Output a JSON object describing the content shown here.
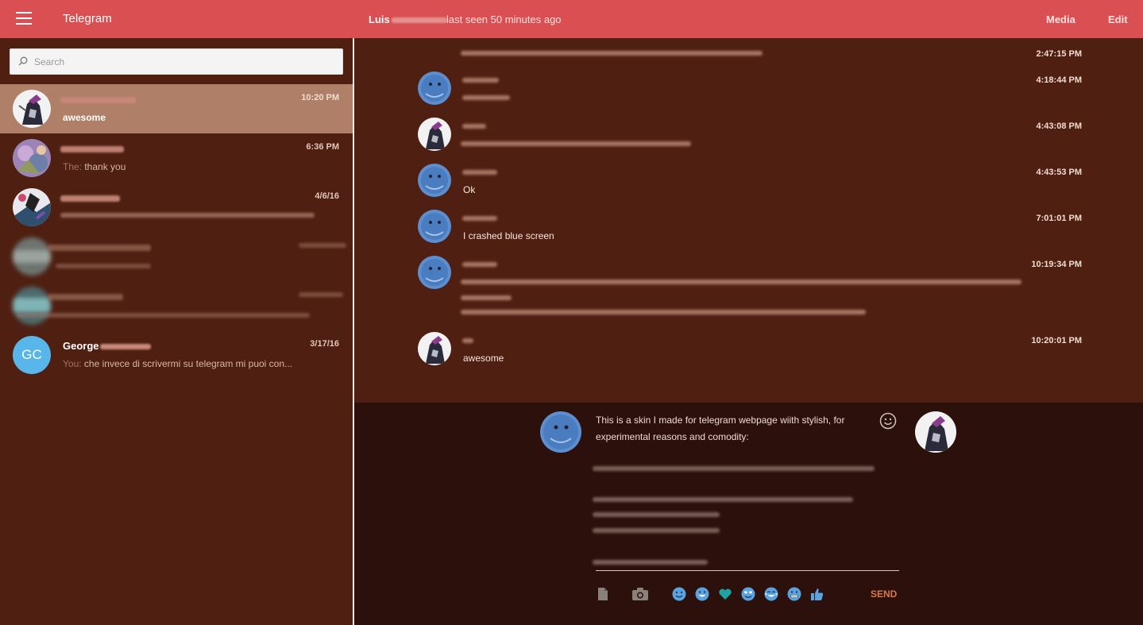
{
  "header": {
    "app_title": "Telegram",
    "peer_name": "Luis",
    "peer_status": "last seen 50 minutes ago",
    "media_label": "Media",
    "edit_label": "Edit"
  },
  "search": {
    "placeholder": "Search"
  },
  "dialogs": [
    {
      "time": "10:20 PM",
      "message": "awesome"
    },
    {
      "time": "6:36 PM",
      "from": "The:",
      "message": " thank you"
    },
    {
      "time": "4/6/16"
    },
    {},
    {},
    {
      "avatar_initials": "GC",
      "name": "George",
      "time": "3/17/16",
      "from": "You:",
      "message": " che invece di scrivermi su telegram mi puoi con..."
    }
  ],
  "messages": [
    {
      "time": "2:47:15 PM"
    },
    {
      "time": "4:18:44 PM"
    },
    {
      "time": "4:43:08 PM"
    },
    {
      "time": "4:43:53 PM",
      "text": "Ok"
    },
    {
      "time": "7:01:01 PM",
      "text": "I crashed blue screen"
    },
    {
      "time": "10:19:34 PM"
    },
    {
      "time": "10:20:01 PM",
      "text": "awesome"
    }
  ],
  "composer": {
    "draft_text": "This is a skin I made for telegram webpage wiith stylish, for experimental reasons and comodity:",
    "send_label": "SEND"
  },
  "colors": {
    "topbar": "#d94f52",
    "sidebar": "#4f2012",
    "active_dialog": "#b07f67",
    "composer": "#2c100b",
    "send": "#d9784b"
  },
  "icons": [
    "menu-icon",
    "search-icon",
    "smile-icon",
    "file-icon",
    "camera-icon",
    "emoji-smile-icon",
    "emoji-grin-icon",
    "emoji-heart-icon",
    "emoji-heart-eyes-icon",
    "emoji-laugh-tears-icon",
    "emoji-grimace-icon",
    "emoji-thumbs-up-icon"
  ]
}
